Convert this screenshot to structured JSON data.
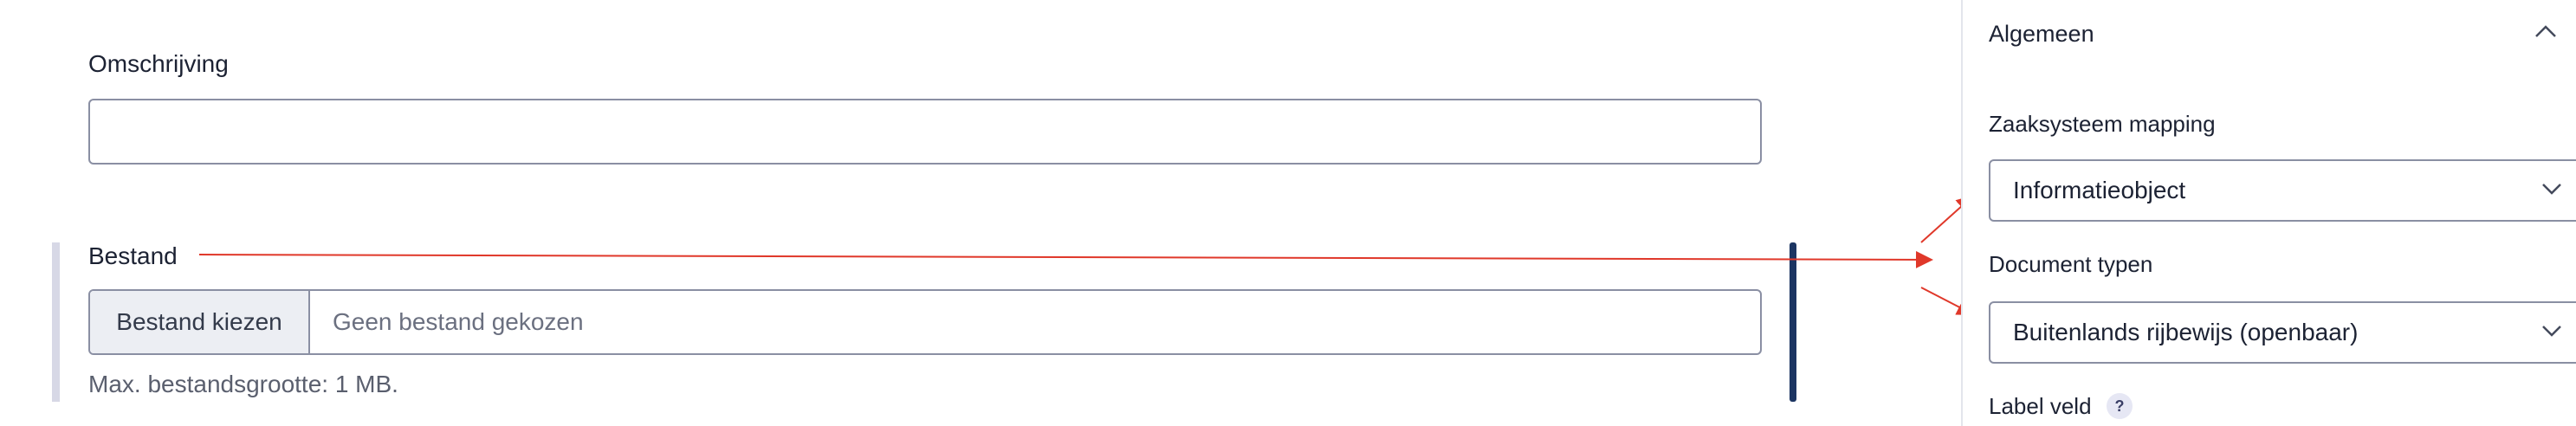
{
  "form": {
    "omschrijving_label": "Omschrijving",
    "omschrijving_value": "",
    "bestand_label": "Bestand",
    "file_button_label": "Bestand kiezen",
    "file_status": "Geen bestand gekozen",
    "max_size": "Max. bestandsgrootte: 1 MB."
  },
  "panel": {
    "header": "Algemeen",
    "zaaksysteem_label": "Zaaksysteem mapping",
    "zaaksysteem_value": "Informatieobject",
    "document_typen_label": "Document typen",
    "document_typen_value": "Buitenlands rijbewijs (openbaar)",
    "label_veld_label": "Label veld",
    "help_badge": "?"
  },
  "colors": {
    "annotation_arrow": "#e0382a",
    "drag_handle": "#1c3562",
    "border": "#8a8fa3"
  },
  "icons": [
    "chevron-up-icon",
    "chevron-down-icon",
    "help-icon"
  ]
}
